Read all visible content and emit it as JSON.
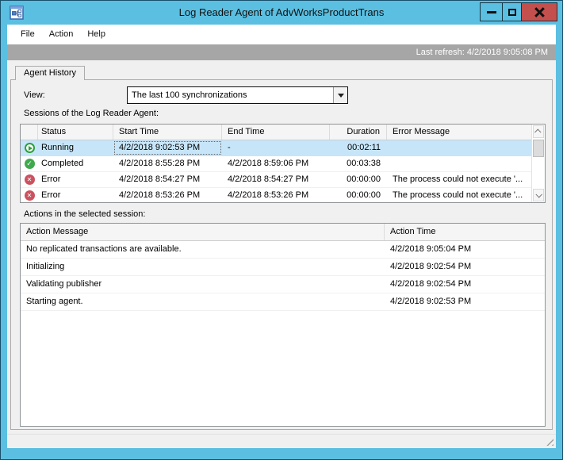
{
  "window": {
    "title": "Log Reader Agent of AdvWorksProductTrans",
    "controls": {
      "minimize": "minimize-icon",
      "maximize": "maximize-icon",
      "close": "close-icon"
    }
  },
  "menu": {
    "items": [
      {
        "label": "File"
      },
      {
        "label": "Action"
      },
      {
        "label": "Help"
      }
    ]
  },
  "refresh": {
    "label": "Last refresh: 4/2/2018 9:05:08 PM"
  },
  "tab": {
    "label": "Agent History"
  },
  "view": {
    "label": "View:",
    "selected": "The last 100 synchronizations"
  },
  "sessions": {
    "label": "Sessions of the Log Reader Agent:",
    "columns": [
      "",
      "Status",
      "Start Time",
      "End Time",
      "Duration",
      "Error Message"
    ],
    "rows": [
      {
        "icon": "running-icon",
        "status": "Running",
        "start": "4/2/2018 9:02:53 PM",
        "end": "-",
        "duration": "00:02:11",
        "error": "",
        "selected": true
      },
      {
        "icon": "completed-icon",
        "status": "Completed",
        "start": "4/2/2018 8:55:28 PM",
        "end": "4/2/2018 8:59:06 PM",
        "duration": "00:03:38",
        "error": "",
        "selected": false
      },
      {
        "icon": "error-icon",
        "status": "Error",
        "start": "4/2/2018 8:54:27 PM",
        "end": "4/2/2018 8:54:27 PM",
        "duration": "00:00:00",
        "error": "The process could not execute '...",
        "selected": false
      },
      {
        "icon": "error-icon",
        "status": "Error",
        "start": "4/2/2018 8:53:26 PM",
        "end": "4/2/2018 8:53:26 PM",
        "duration": "00:00:00",
        "error": "The process could not execute '...",
        "selected": false
      }
    ]
  },
  "actions": {
    "label": "Actions in the selected session:",
    "columns": [
      "Action Message",
      "Action Time"
    ],
    "rows": [
      {
        "message": "No replicated transactions are available.",
        "time": "4/2/2018 9:05:04 PM"
      },
      {
        "message": "Initializing",
        "time": "4/2/2018 9:02:54 PM"
      },
      {
        "message": "Validating publisher",
        "time": "4/2/2018 9:02:54 PM"
      },
      {
        "message": "Starting agent.",
        "time": "4/2/2018 9:02:53 PM"
      }
    ]
  },
  "colors": {
    "titlebar": "#5ABFE1",
    "close_button": "#C4504E",
    "refresh_bar": "#A6A6A6",
    "selection": "#C7E5F9",
    "running_green": "#2CA03A",
    "completed_green": "#3FA94D",
    "error_red": "#CB5260"
  }
}
